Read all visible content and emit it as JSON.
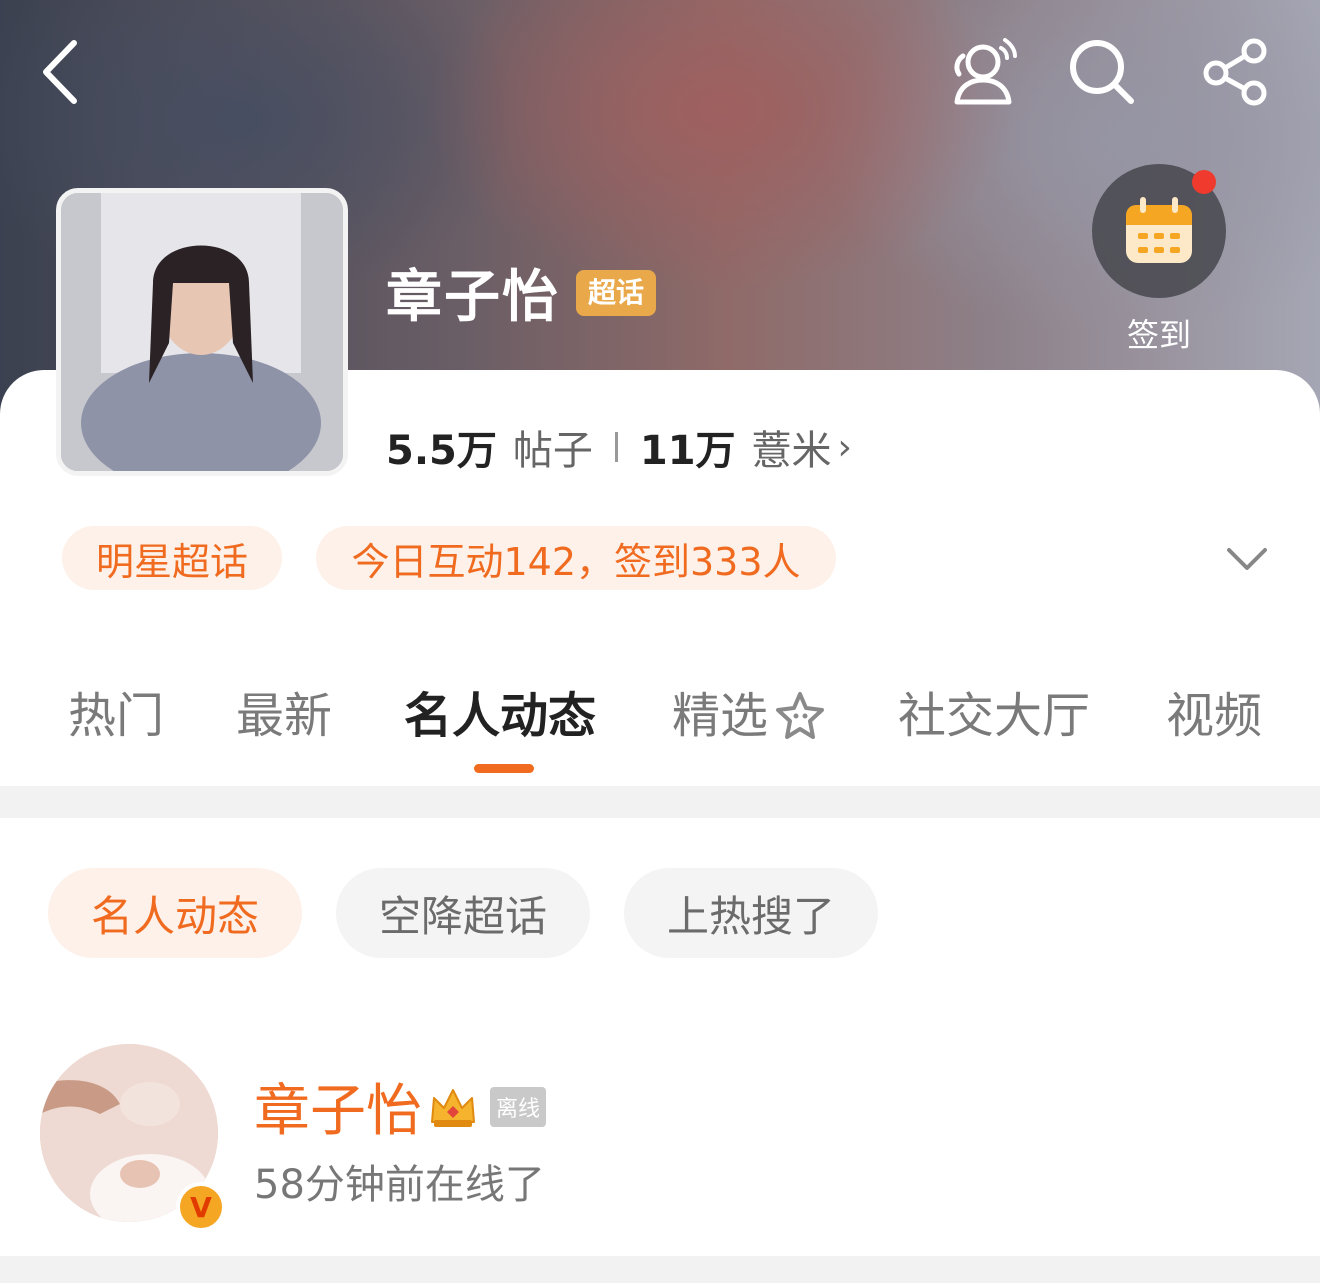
{
  "header": {
    "title": "章子怡",
    "super_tag": "超话",
    "checkin_label": "签到",
    "icons": [
      "back-icon",
      "people-icon",
      "search-icon",
      "share-icon",
      "calendar-icon"
    ]
  },
  "stats": {
    "posts_count": "5.5万",
    "posts_label": "帖子",
    "fans_count": "11万",
    "fans_label": "薏米",
    "chevron": "›"
  },
  "pills": {
    "category": "明星超话",
    "activity": "今日互动142，签到333人"
  },
  "tabs": [
    {
      "label": "热门"
    },
    {
      "label": "最新"
    },
    {
      "label": "名人动态"
    },
    {
      "label": "精选"
    },
    {
      "label": "社交大厅"
    },
    {
      "label": "视频"
    }
  ],
  "active_tab": "名人动态",
  "chips": [
    {
      "label": "名人动态"
    },
    {
      "label": "空降超话"
    },
    {
      "label": "上热搜了"
    }
  ],
  "user": {
    "name": "章子怡",
    "offline_tag": "离线",
    "status": "58分钟前在线了",
    "badge": "V"
  },
  "colors": {
    "accent": "#f06b1f",
    "super_tag": "#e9a94a",
    "pill_bg": "#fdf1ea"
  }
}
